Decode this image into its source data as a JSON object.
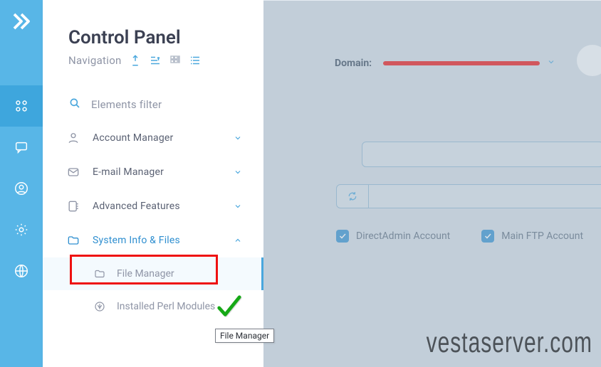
{
  "sidebar": {
    "title": "Control Panel",
    "subtitle": "Navigation",
    "filter_placeholder": "Elements filter",
    "items": [
      {
        "label": "Account Manager"
      },
      {
        "label": "E-mail Manager"
      },
      {
        "label": "Advanced Features"
      },
      {
        "label": "System Info & Files"
      }
    ],
    "subitems": [
      {
        "label": "File Manager"
      },
      {
        "label": "Installed Perl Modules"
      }
    ]
  },
  "main": {
    "domain_label": "Domain:",
    "checkbox1_label": "DirectAdmin Account",
    "checkbox2_label": "Main FTP Account"
  },
  "tooltip": {
    "text": "File Manager"
  },
  "watermark": "vestaserver.com"
}
